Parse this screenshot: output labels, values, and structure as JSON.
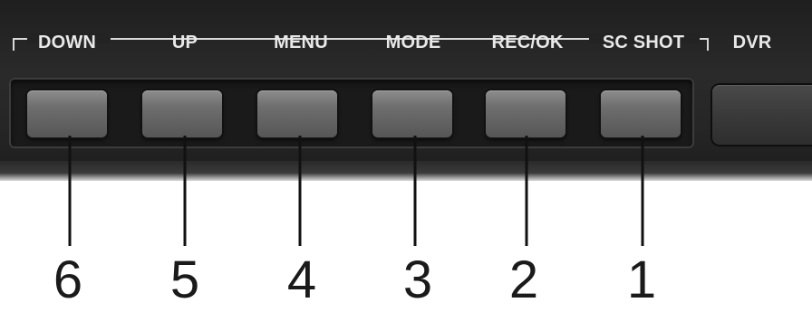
{
  "panel": {
    "buttons": [
      {
        "label": "DOWN",
        "number": "6"
      },
      {
        "label": "UP",
        "number": "5"
      },
      {
        "label": "MENU",
        "number": "4"
      },
      {
        "label": "MODE",
        "number": "3"
      },
      {
        "label": "REC/OK",
        "number": "2"
      },
      {
        "label": "SC SHOT",
        "number": "1"
      }
    ],
    "dvr_label": "DVR"
  },
  "colors": {
    "panel": "#262626",
    "button": "#6e6e6e",
    "label_text": "#e8e8e8",
    "callout_text": "#1a1a1a"
  }
}
